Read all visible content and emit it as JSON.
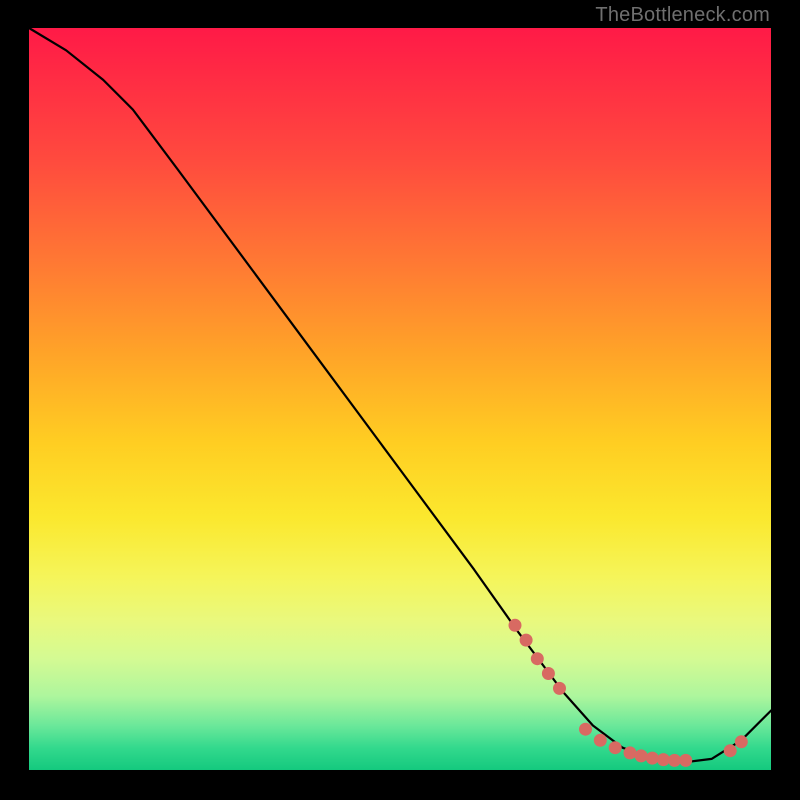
{
  "watermark": "TheBottleneck.com",
  "chart_data": {
    "type": "line",
    "title": "",
    "xlabel": "",
    "ylabel": "",
    "xlim": [
      0,
      100
    ],
    "ylim": [
      0,
      100
    ],
    "grid": false,
    "series": [
      {
        "name": "curve",
        "x": [
          0,
          5,
          10,
          14,
          20,
          30,
          40,
          50,
          60,
          66,
          72,
          76,
          80,
          84,
          88,
          92,
          96,
          100
        ],
        "y": [
          100,
          97,
          93,
          89,
          81,
          67.5,
          54,
          40.5,
          27,
          18.5,
          10.5,
          6,
          3,
          1.5,
          1,
          1.5,
          4,
          8
        ]
      }
    ],
    "points": [
      {
        "name": "cluster-left",
        "x": [
          65.5,
          67,
          68.5,
          70,
          71.5
        ],
        "y": [
          19.5,
          17.5,
          15,
          13,
          11
        ]
      },
      {
        "name": "cluster-bottom",
        "x": [
          75,
          77,
          79,
          81,
          82.5,
          84,
          85.5,
          87,
          88.5
        ],
        "y": [
          5.5,
          4,
          3,
          2.3,
          1.9,
          1.6,
          1.4,
          1.3,
          1.3
        ]
      },
      {
        "name": "cluster-right",
        "x": [
          94.5,
          96
        ],
        "y": [
          2.6,
          3.8
        ]
      }
    ],
    "colors": {
      "curve": "#000000",
      "points": "#d86a62",
      "gradient_top": "#ff1a47",
      "gradient_bottom": "#14c97e"
    }
  }
}
